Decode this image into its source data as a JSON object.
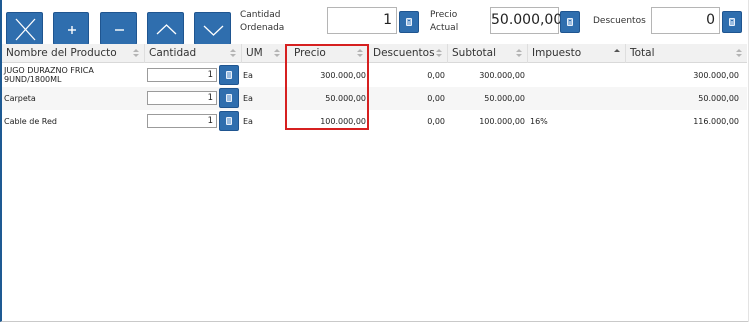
{
  "toolbar": {
    "cantidad_label": "Cantidad\nOrdenada",
    "cantidad_value": "1",
    "precio_label": "Precio\nActual",
    "precio_value": "50.000,00",
    "descuentos_label": "Descuentos",
    "descuentos_value": "0"
  },
  "table": {
    "columns": [
      "Nombre del Producto",
      "Cantidad",
      "UM",
      "Precio",
      "Descuentos",
      "Subtotal",
      "Impuesto",
      "Total"
    ],
    "rows": [
      {
        "name": "JUGO DURAZNO FRICA\n9UND/1800ML",
        "qty": "1",
        "um": "Ea",
        "precio": "300.000,00",
        "descuentos": "0,00",
        "subtotal": "300.000,00",
        "impuesto": "",
        "total": "300.000,00"
      },
      {
        "name": "Carpeta",
        "qty": "1",
        "um": "Ea",
        "precio": "50.000,00",
        "descuentos": "0,00",
        "subtotal": "50.000,00",
        "impuesto": "",
        "total": "50.000,00"
      },
      {
        "name": "Cable de Red",
        "qty": "1",
        "um": "Ea",
        "precio": "100.000,00",
        "descuentos": "0,00",
        "subtotal": "100.000,00",
        "impuesto": "16%",
        "total": "116.000,00"
      }
    ]
  },
  "colors": {
    "button": "#2f6eae",
    "highlight": "#d62020"
  },
  "icons": {
    "delete": "x-icon",
    "add": "plus-icon",
    "remove": "minus-icon",
    "up": "chevron-up-icon",
    "down": "chevron-down-icon",
    "calculator": "calculator-icon"
  }
}
